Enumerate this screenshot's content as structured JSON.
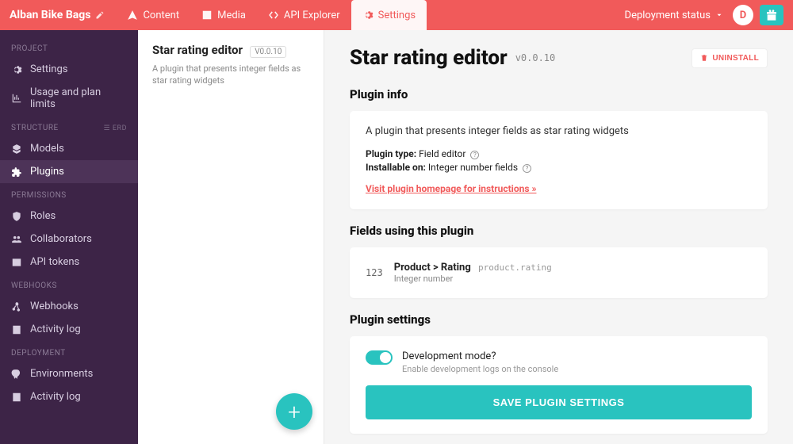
{
  "header": {
    "site_name": "Alban Bike Bags",
    "nav": [
      {
        "label": "Content",
        "icon": "pen"
      },
      {
        "label": "Media",
        "icon": "image"
      },
      {
        "label": "API Explorer",
        "icon": "code"
      },
      {
        "label": "Settings",
        "icon": "gear"
      }
    ],
    "deploy_label": "Deployment status",
    "avatar_letter": "D"
  },
  "sidebar": {
    "groups": [
      {
        "title": "PROJECT",
        "items": [
          {
            "label": "Settings",
            "icon": "gear"
          },
          {
            "label": "Usage and plan limits",
            "icon": "chart"
          }
        ]
      },
      {
        "title": "STRUCTURE",
        "badge": "☰ ERD",
        "items": [
          {
            "label": "Models",
            "icon": "cubes"
          },
          {
            "label": "Plugins",
            "icon": "puzzle",
            "active": true
          }
        ]
      },
      {
        "title": "PERMISSIONS",
        "items": [
          {
            "label": "Roles",
            "icon": "shield"
          },
          {
            "label": "Collaborators",
            "icon": "users"
          },
          {
            "label": "API tokens",
            "icon": "key"
          }
        ]
      },
      {
        "title": "WEBHOOKS",
        "items": [
          {
            "label": "Webhooks",
            "icon": "hook"
          },
          {
            "label": "Activity log",
            "icon": "log"
          }
        ]
      },
      {
        "title": "DEPLOYMENT",
        "items": [
          {
            "label": "Environments",
            "icon": "rocket"
          },
          {
            "label": "Activity log",
            "icon": "log"
          }
        ]
      }
    ]
  },
  "second_pane": {
    "title": "Star rating editor",
    "version": "V0.0.10",
    "desc": "A plugin that presents integer fields as star rating widgets"
  },
  "main": {
    "title": "Star rating editor",
    "version": "v0.0.10",
    "uninstall_label": "UNINSTALL",
    "plugin_info": {
      "heading": "Plugin info",
      "desc": "A plugin that presents integer fields as star rating widgets",
      "type_label": "Plugin type:",
      "type_value": "Field editor",
      "install_label": "Installable on:",
      "install_value": "Integer number fields",
      "homepage_link": "Visit plugin homepage for instructions »"
    },
    "fields": {
      "heading": "Fields using this plugin",
      "items": [
        {
          "badge": "123",
          "path": "Product > Rating",
          "code": "product.rating",
          "type": "Integer number"
        }
      ]
    },
    "settings": {
      "heading": "Plugin settings",
      "toggle_label": "Development mode?",
      "toggle_sub": "Enable development logs on the console",
      "save_label": "SAVE PLUGIN SETTINGS"
    }
  }
}
